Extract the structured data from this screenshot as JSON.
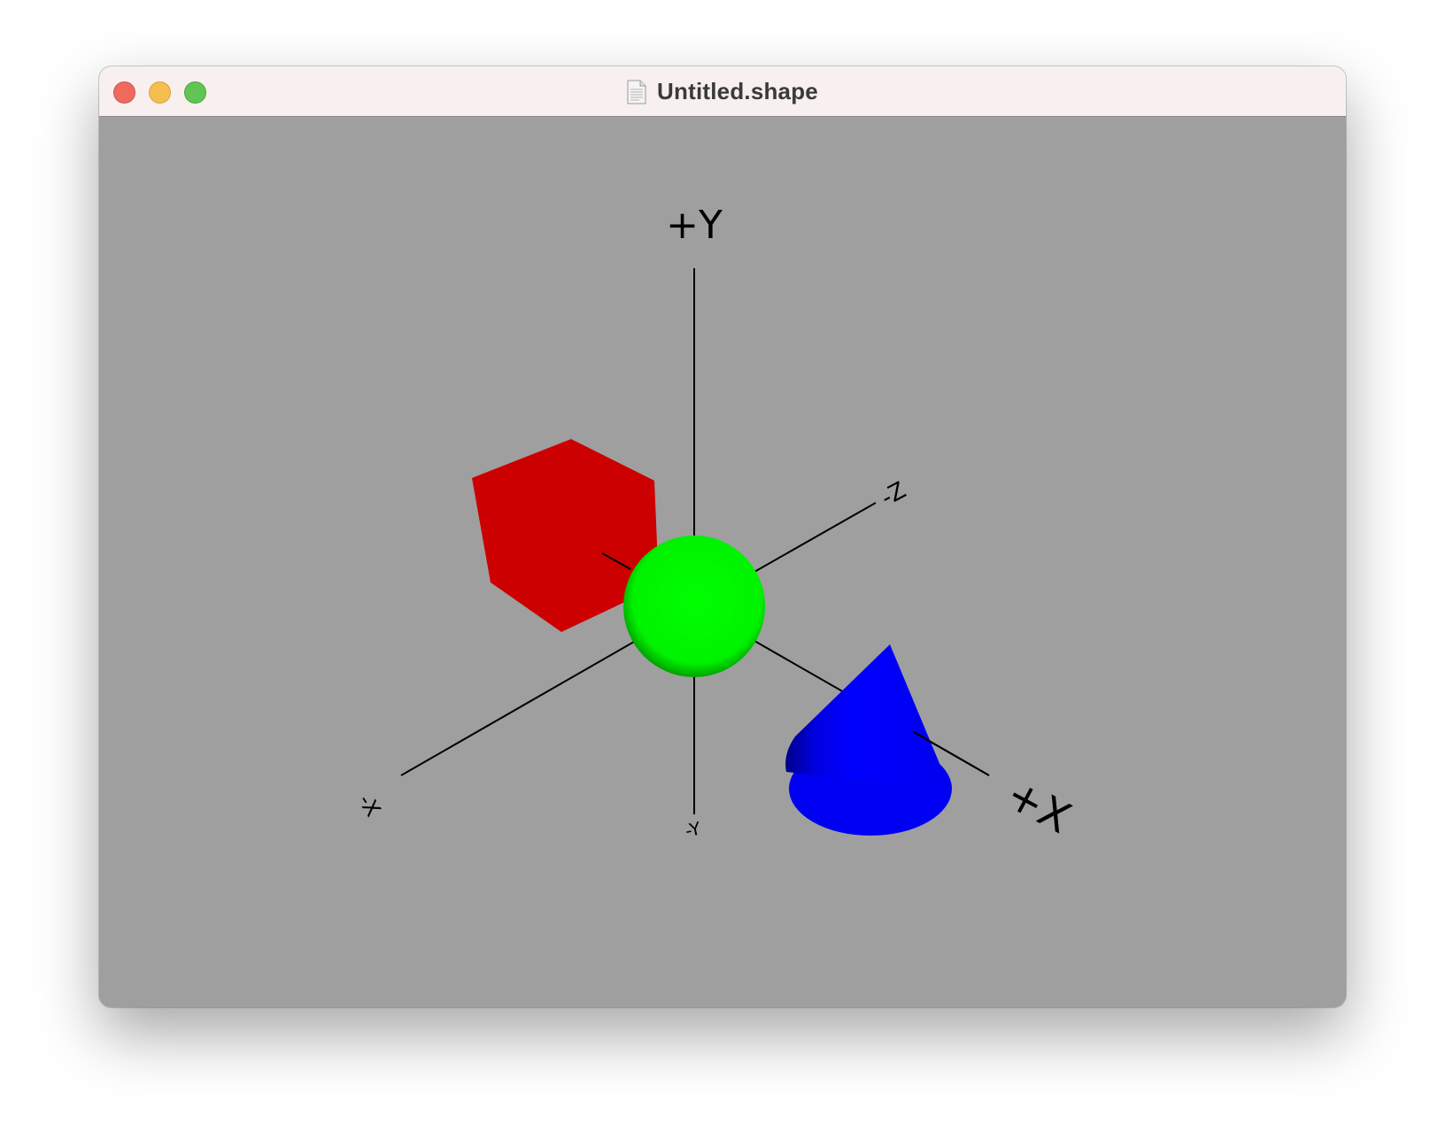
{
  "window": {
    "title": "Untitled.shape",
    "document_icon": "document-icon"
  },
  "traffic_lights": {
    "close": "close-button",
    "minimize": "minimize-button",
    "maximize": "maximize-button"
  },
  "scene": {
    "background_color": "#9f9f9f",
    "axis_labels": {
      "pos_y": "+Y",
      "neg_z": "-Z",
      "pos_x": "+X",
      "neg_y": "-Y",
      "neg_x": "-X"
    },
    "objects": [
      {
        "shape": "cube",
        "color": "#cc0000"
      },
      {
        "shape": "sphere",
        "color": "#00ff00"
      },
      {
        "shape": "cone",
        "color": "#0000ff"
      }
    ]
  }
}
